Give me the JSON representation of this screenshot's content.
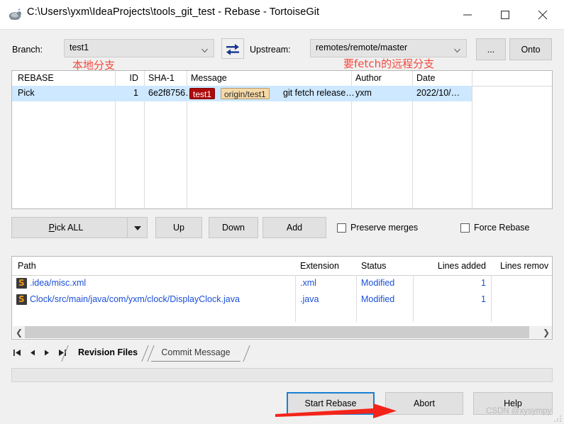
{
  "window": {
    "title": "C:\\Users\\yxm\\IdeaProjects\\tools_git_test - Rebase - TortoiseGit",
    "app_icon": "tortoisegit-icon",
    "controls": {
      "minimize": "minimize-icon",
      "maximize": "maximize-icon",
      "close": "close-icon"
    }
  },
  "branch_row": {
    "branch_label": "Branch:",
    "branch_value": "test1",
    "swap_icon": "swap-arrows-icon",
    "upstream_label": "Upstream:",
    "upstream_value": "remotes/remote/master",
    "browse_label": "...",
    "onto_label": "Onto"
  },
  "annotations": {
    "local_branch": "本地分支",
    "remote_branch": "要fetch的远程分支",
    "color": "#f4483c",
    "arrow": "red-arrow-pointing-to-start-rebase"
  },
  "commit_list": {
    "columns": [
      "REBASE",
      "ID",
      "SHA-1",
      "Message",
      "Author",
      "Date"
    ],
    "rows": [
      {
        "rebase": "Pick",
        "id": "1",
        "sha1": "6e2f8756…",
        "ref_badges": [
          {
            "label": "test1",
            "style": "red"
          },
          {
            "label": "origin/test1",
            "style": "tan"
          }
        ],
        "message": "git fetch release…",
        "author": "yxm",
        "date": "2022/10/…",
        "selected": true
      }
    ],
    "selection_color": "#cde8ff"
  },
  "toolbar": {
    "pick_all_label": "Pick ALL",
    "pick_all_mnemonic": "P",
    "dropdown_icon": "chevron-down-icon",
    "up_label": "Up",
    "down_label": "Down",
    "add_label": "Add",
    "preserve_merges_label": "Preserve merges",
    "preserve_merges_checked": false,
    "force_rebase_label": "Force Rebase",
    "force_rebase_checked": false
  },
  "file_list": {
    "columns": [
      "Path",
      "Extension",
      "Status",
      "Lines added",
      "Lines remov"
    ],
    "rows": [
      {
        "icon": "modified-file-icon",
        "path": ".idea/misc.xml",
        "extension": ".xml",
        "status": "Modified",
        "lines_added": "1",
        "lines_removed": ""
      },
      {
        "icon": "modified-file-icon",
        "path": "Clock/src/main/java/com/yxm/clock/DisplayClock.java",
        "extension": ".java",
        "status": "Modified",
        "lines_added": "1",
        "lines_removed": ""
      }
    ],
    "text_color": "#1a4fd6",
    "scroll_left_icon": "chevron-left-icon",
    "scroll_right_icon": "chevron-right-icon"
  },
  "tabs": {
    "nav": [
      "first-icon",
      "previous-icon",
      "next-icon",
      "last-icon"
    ],
    "items": [
      {
        "label": "Revision Files",
        "active": true
      },
      {
        "label": "Commit Message",
        "active": false
      }
    ]
  },
  "status_bar": {
    "text": ""
  },
  "bottom_buttons": {
    "start_rebase_label": "Start Rebase",
    "start_rebase_focus_color": "#1a7fd4",
    "abort_label": "Abort",
    "help_label": "Help"
  },
  "watermark": {
    "text": "CSDN @xysympy"
  }
}
